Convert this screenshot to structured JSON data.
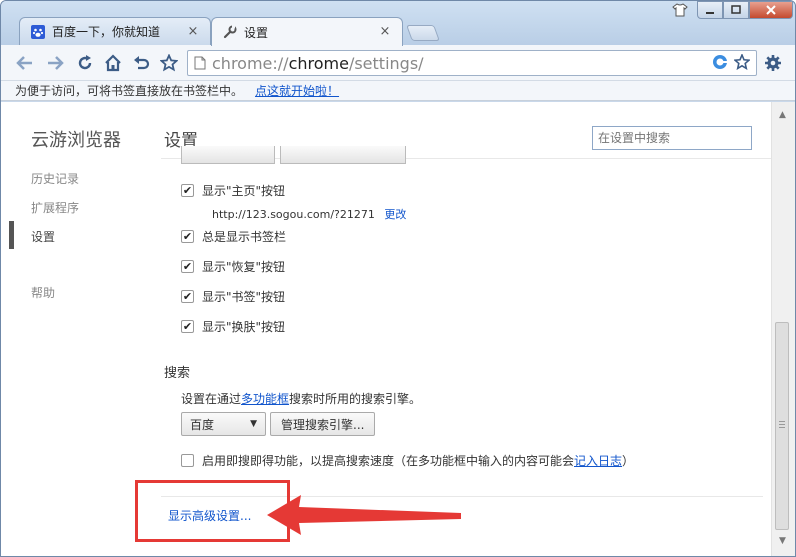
{
  "tabs": [
    {
      "title": "百度一下，你就知道",
      "icon": "baidu-paw-icon"
    },
    {
      "title": "设置",
      "icon": "wrench-icon"
    }
  ],
  "omnibox": {
    "url_scheme": "chrome://",
    "url_host": "chrome",
    "url_path": "/settings/"
  },
  "bookmark_bar": {
    "message": "为便于访问，可将书签直接放在书签栏中。",
    "link": "点这就开始啦！"
  },
  "sidebar": {
    "brand": "云游浏览器",
    "items": [
      {
        "label": "历史记录"
      },
      {
        "label": "扩展程序"
      },
      {
        "label": "设置"
      },
      {
        "label": "帮助"
      }
    ]
  },
  "main": {
    "title": "设置",
    "search_placeholder": "在设置中搜索",
    "appearance": {
      "show_home": "显示\"主页\"按钮",
      "homepage_url": "http://123.sogou.com/?21271",
      "change_link": "更改",
      "show_bookmarks_bar": "总是显示书签栏",
      "show_restore": "显示\"恢复\"按钮",
      "show_bookmark": "显示\"书签\"按钮",
      "show_skin": "显示\"换肤\"按钮"
    },
    "search": {
      "heading": "搜索",
      "desc_before": "设置在通过",
      "desc_link": "多功能框",
      "desc_after": "搜索时所用的搜索引擎。",
      "engine_selected": "百度",
      "manage_button": "管理搜索引擎...",
      "instant_before": "启用即搜即得功能，以提高搜索速度（在多功能框中输入的内容可能会",
      "instant_link": "记入日志",
      "instant_after": "）"
    },
    "advanced_link": "显示高级设置..."
  },
  "colors": {
    "link": "#1155cc",
    "annotation": "#e53935"
  }
}
